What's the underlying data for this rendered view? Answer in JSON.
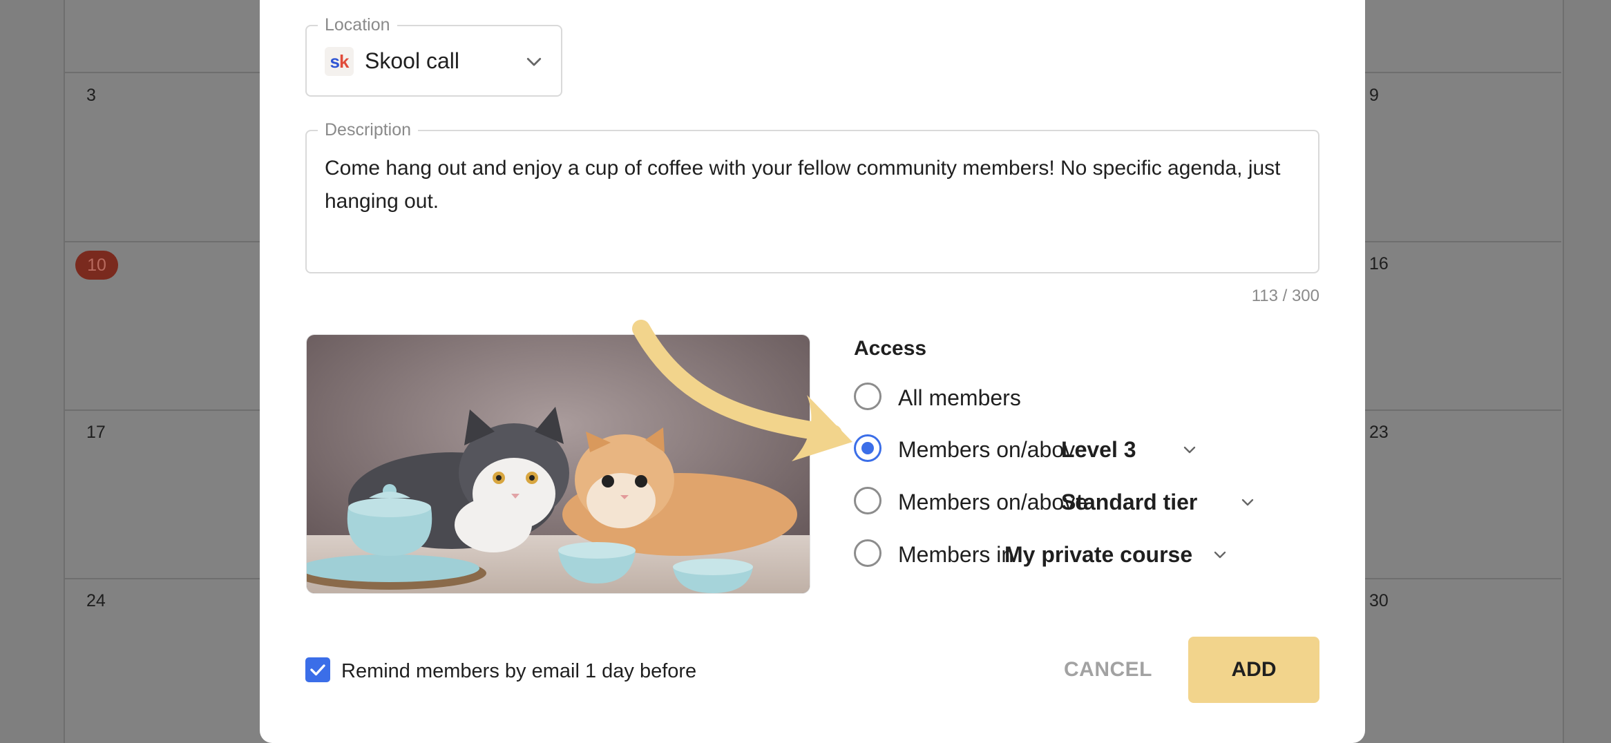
{
  "calendar": {
    "days": [
      "3",
      "9",
      "10",
      "16",
      "17",
      "23",
      "24",
      "30"
    ]
  },
  "location": {
    "legend": "Location",
    "icon_text_s": "s",
    "icon_text_k": "k",
    "value": "Skool call"
  },
  "description": {
    "legend": "Description",
    "value": "Come hang out and enjoy a cup of coffee with your fellow community members! No specific agenda, just hanging out.",
    "counter": "113 / 300"
  },
  "access": {
    "title": "Access",
    "options": [
      {
        "label": "All members",
        "select": "",
        "checked": false
      },
      {
        "label": "Members on/above",
        "select": "Level 3",
        "checked": true
      },
      {
        "label": "Members on/above",
        "select": "Standard tier",
        "checked": false
      },
      {
        "label": "Members in",
        "select": "My private course",
        "checked": false
      }
    ]
  },
  "remind": {
    "label": "Remind members by email 1 day before",
    "checked": true
  },
  "buttons": {
    "cancel": "CANCEL",
    "add": "ADD"
  },
  "colors": {
    "accent": "#3b6ee8",
    "add_button": "#f2d48c",
    "arrow": "#f2d48c",
    "today_badge": "#7a2a1e"
  }
}
